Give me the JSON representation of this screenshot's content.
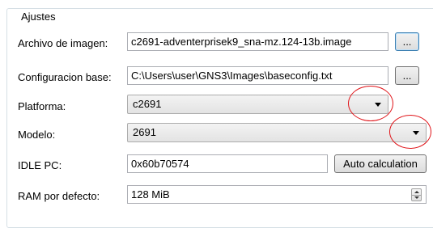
{
  "group": {
    "title": "Ajustes"
  },
  "image_file": {
    "label": "Archivo de imagen:",
    "value": "c2691-adventerprisek9_sna-mz.124-13b.image",
    "browse_label": "..."
  },
  "base_config": {
    "label": "Configuracion base:",
    "value": "C:\\Users\\user\\GNS3\\Images\\baseconfig.txt",
    "browse_label": "..."
  },
  "platform": {
    "label": "Platforma:",
    "value": "c2691"
  },
  "model": {
    "label": "Modelo:",
    "value": "2691"
  },
  "idle_pc": {
    "label": "IDLE PC:",
    "value": "0x60b70574",
    "auto_button_label": "Auto calculation"
  },
  "ram": {
    "label": "RAM por defecto:",
    "value": "128 MiB"
  },
  "annotations": {
    "circle_color": "#e0151a"
  },
  "icons": [
    "chevron-down-icon",
    "spin-up-icon",
    "spin-down-icon"
  ]
}
